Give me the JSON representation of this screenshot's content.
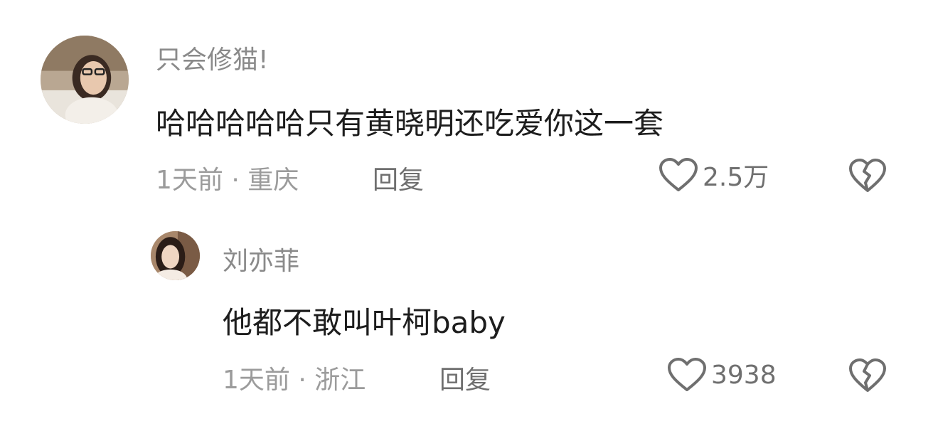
{
  "comments": [
    {
      "username": "只会修猫!",
      "content": "哈哈哈哈哈只有黄晓明还吃爱你这一套",
      "meta": "1天前 · 重庆",
      "reply_label": "回复",
      "likes": "2.5万"
    },
    {
      "username": "刘亦菲",
      "content": "他都不敢叫叶柯baby",
      "meta": "1天前 · 浙江",
      "reply_label": "回复",
      "likes": "3938"
    }
  ],
  "icons": {
    "like": "heart-outline-icon",
    "dislike": "broken-heart-icon"
  },
  "colors": {
    "username": "#8a8a8a",
    "content": "#1d1d1d",
    "meta": "#9b9b9b",
    "action": "#6f6f6f"
  }
}
